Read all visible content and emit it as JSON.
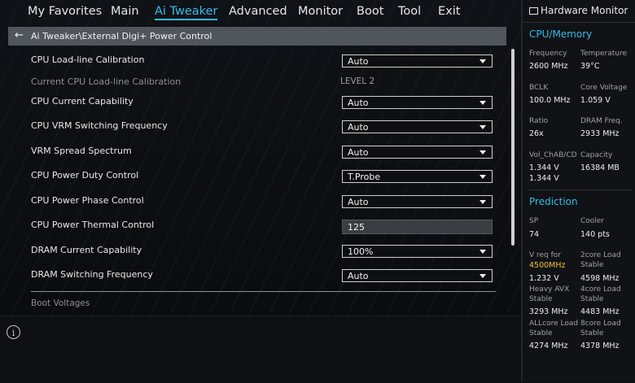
{
  "menu": {
    "tabs": [
      "My Favorites",
      "Main",
      "Ai Tweaker",
      "Advanced",
      "Monitor",
      "Boot",
      "Tool",
      "Exit"
    ],
    "active_tab": "Ai Tweaker"
  },
  "breadcrumb": {
    "path": "Ai Tweaker\\External Digi+ Power Control"
  },
  "settings": [
    {
      "label": "CPU Load-line Calibration",
      "value": "Auto"
    },
    {
      "label": "Current CPU Load-line Calibration",
      "value": "LEVEL 2"
    },
    {
      "label": "CPU Current Capability",
      "value": "Auto"
    },
    {
      "label": "CPU VRM Switching Frequency",
      "value": "Auto"
    },
    {
      "label": "VRM Spread Spectrum",
      "value": "Auto"
    },
    {
      "label": "CPU Power Duty Control",
      "value": "T.Probe"
    },
    {
      "label": "CPU Power Phase Control",
      "value": "Auto"
    },
    {
      "label": "CPU Power Thermal Control",
      "value": "125"
    },
    {
      "label": "DRAM Current Capability",
      "value": "100%"
    },
    {
      "label": "DRAM Switching Frequency",
      "value": "Auto"
    }
  ],
  "boot_voltages": "Boot Voltages",
  "hw": {
    "title": "Hardware Monitor",
    "cpu_memory": "CPU/Memory",
    "frequency_label": "Frequency",
    "frequency": "2600 MHz",
    "temperature_label": "Temperature",
    "temperature": "39°C",
    "bclk_label": "BCLK",
    "bclk": "100.0 MHz",
    "core_voltage_label": "Core Voltage",
    "core_voltage": "1.059 V",
    "ratio_label": "Ratio",
    "ratio": "26x",
    "dram_freq_label": "DRAM Freq.",
    "dram_freq": "2933 MHz",
    "vol_label": "Vol_ChAB/CD",
    "vol_1": "1.344 V",
    "vol_2": "1.344 V",
    "capacity_label": "Capacity",
    "capacity": "16384 MB",
    "prediction": "Prediction",
    "sp_label": "SP",
    "sp": "74",
    "cooler_label": "Cooler",
    "cooler": "140 pts",
    "vreq_label": "V req for",
    "vreq_freq": "4500MHz",
    "vreq": "1.232 V",
    "twocore_label_1": "2core Load",
    "twocore_label_2": "Stable",
    "twocore": "4598 MHz",
    "avx_label_1": "Heavy AVX",
    "avx_label_2": "Stable",
    "avx": "3293 MHz",
    "fourcore_label_1": "4core Load",
    "fourcore_label_2": "Stable",
    "fourcore": "4483 MHz",
    "allcore_label_1": "ALLcore Load",
    "allcore_label_2": "Stable",
    "allcore": "4274 MHz",
    "eightcore_label_1": "8core Load",
    "eightcore_label_2": "Stable",
    "eightcore": "4378 MHz"
  },
  "colors": {
    "accent": "#39b9e8",
    "highlight": "#f2c232"
  }
}
